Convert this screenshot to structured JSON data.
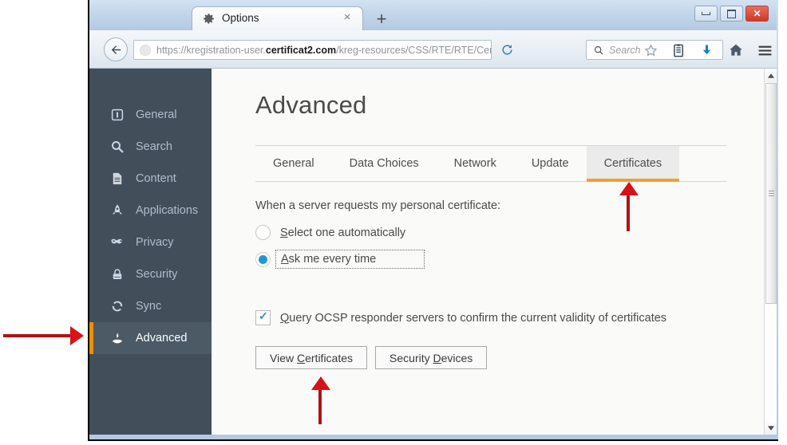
{
  "window": {
    "tab_title": "Options",
    "tab_icon": "gear-icon",
    "close_tab_glyph": "×",
    "new_tab_glyph": "+",
    "minimize_label": "",
    "maximize_label": "",
    "close_label": "✕"
  },
  "navbar": {
    "back_glyph": "←",
    "url_prefix": "https://kregistration-user.",
    "url_domain": "certificat2.com",
    "url_suffix": "/kreg-resources/CSS/RTE/RTE/Cer",
    "url_dropdown_glyph": "▽",
    "reload_icon": "reload-icon",
    "search_placeholder": "Search",
    "search_icon": "search-icon",
    "bookmark_icon": "star-icon",
    "library_icon": "library-icon",
    "downloads_icon": "download-arrow-icon",
    "home_icon": "home-icon",
    "menu_icon": "hamburger-menu-icon"
  },
  "sidebar": {
    "items": [
      {
        "label": "General",
        "icon": "general-icon",
        "active": false
      },
      {
        "label": "Search",
        "icon": "search-icon",
        "active": false
      },
      {
        "label": "Content",
        "icon": "content-page-icon",
        "active": false
      },
      {
        "label": "Applications",
        "icon": "rocket-icon",
        "active": false
      },
      {
        "label": "Privacy",
        "icon": "mask-icon",
        "active": false
      },
      {
        "label": "Security",
        "icon": "lock-icon",
        "active": false
      },
      {
        "label": "Sync",
        "icon": "sync-icon",
        "active": false
      },
      {
        "label": "Advanced",
        "icon": "flask-icon",
        "active": true
      }
    ],
    "background": "#424f5a",
    "active_background": "#4c5a66",
    "active_accent": "#f09000"
  },
  "main": {
    "page_title": "Advanced",
    "tabs": [
      {
        "label": "General",
        "selected": false
      },
      {
        "label": "Data Choices",
        "selected": false
      },
      {
        "label": "Network",
        "selected": false
      },
      {
        "label": "Update",
        "selected": false
      },
      {
        "label": "Certificates",
        "selected": true
      }
    ],
    "section_label": "When a server requests my personal certificate:",
    "radios": [
      {
        "label": "Select one automatically",
        "accesskey": "S",
        "selected": false,
        "focused": false
      },
      {
        "label": "Ask me every time",
        "accesskey": "A",
        "selected": true,
        "focused": true
      }
    ],
    "checkbox": {
      "label": "Query OCSP responder servers to confirm the current validity of certificates",
      "accesskey": "Q",
      "checked": true
    },
    "buttons": [
      {
        "label": "View Certificates",
        "accesskey": "C"
      },
      {
        "label": "Security Devices",
        "accesskey": "D"
      }
    ]
  },
  "annotations": {
    "arrow_color": "#b01216",
    "arrow_head_color": "#d81217",
    "pointers": [
      {
        "target": "sidebar-item-advanced",
        "direction": "right"
      },
      {
        "target": "tab-certificates",
        "direction": "up"
      },
      {
        "target": "view-certificates-button",
        "direction": "up"
      }
    ]
  },
  "scrollbar": {
    "up_glyph": "▲",
    "down_glyph": "▼"
  }
}
